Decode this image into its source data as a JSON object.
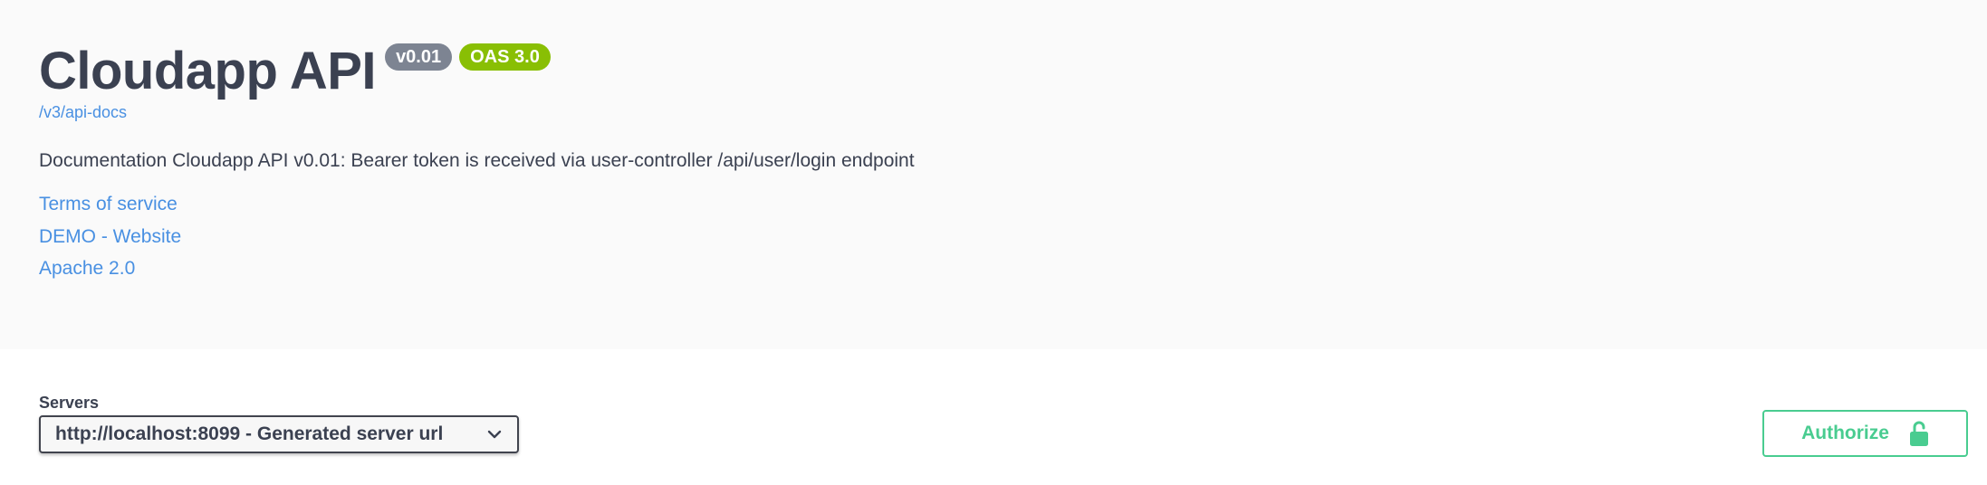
{
  "info": {
    "title": "Cloudapp API",
    "version_badge": "v0.01",
    "oas_badge": "OAS 3.0",
    "spec_url": "/v3/api-docs",
    "description": "Documentation Cloudapp API v0.01: Bearer token is received via user-controller /api/user/login endpoint",
    "links": {
      "terms": "Terms of service",
      "demo": "DEMO - Website",
      "license": "Apache 2.0"
    }
  },
  "servers": {
    "label": "Servers",
    "selected": "http://localhost:8099 - Generated server url"
  },
  "authorize": {
    "label": "Authorize"
  },
  "icons": {
    "dropdown": "chevron-down-icon",
    "authorize": "unlocked-padlock-icon"
  },
  "colors": {
    "link": "#4990e2",
    "text": "#3b4151",
    "version_badge": "#7d8492",
    "oas_badge": "#89bf04",
    "authorize": "#49cc90",
    "info_background": "#fafafa"
  }
}
